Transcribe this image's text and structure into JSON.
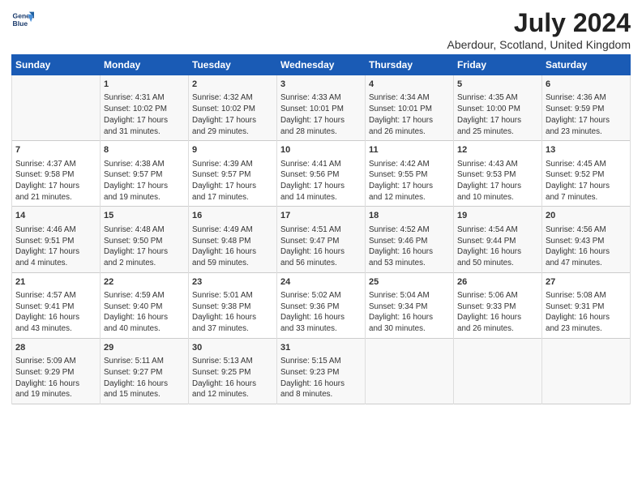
{
  "header": {
    "logo_line1": "General",
    "logo_line2": "Blue",
    "title": "July 2024",
    "subtitle": "Aberdour, Scotland, United Kingdom"
  },
  "days": [
    "Sunday",
    "Monday",
    "Tuesday",
    "Wednesday",
    "Thursday",
    "Friday",
    "Saturday"
  ],
  "weeks": [
    [
      {
        "date": "",
        "lines": []
      },
      {
        "date": "1",
        "lines": [
          "Sunrise: 4:31 AM",
          "Sunset: 10:02 PM",
          "Daylight: 17 hours",
          "and 31 minutes."
        ]
      },
      {
        "date": "2",
        "lines": [
          "Sunrise: 4:32 AM",
          "Sunset: 10:02 PM",
          "Daylight: 17 hours",
          "and 29 minutes."
        ]
      },
      {
        "date": "3",
        "lines": [
          "Sunrise: 4:33 AM",
          "Sunset: 10:01 PM",
          "Daylight: 17 hours",
          "and 28 minutes."
        ]
      },
      {
        "date": "4",
        "lines": [
          "Sunrise: 4:34 AM",
          "Sunset: 10:01 PM",
          "Daylight: 17 hours",
          "and 26 minutes."
        ]
      },
      {
        "date": "5",
        "lines": [
          "Sunrise: 4:35 AM",
          "Sunset: 10:00 PM",
          "Daylight: 17 hours",
          "and 25 minutes."
        ]
      },
      {
        "date": "6",
        "lines": [
          "Sunrise: 4:36 AM",
          "Sunset: 9:59 PM",
          "Daylight: 17 hours",
          "and 23 minutes."
        ]
      }
    ],
    [
      {
        "date": "7",
        "lines": [
          "Sunrise: 4:37 AM",
          "Sunset: 9:58 PM",
          "Daylight: 17 hours",
          "and 21 minutes."
        ]
      },
      {
        "date": "8",
        "lines": [
          "Sunrise: 4:38 AM",
          "Sunset: 9:57 PM",
          "Daylight: 17 hours",
          "and 19 minutes."
        ]
      },
      {
        "date": "9",
        "lines": [
          "Sunrise: 4:39 AM",
          "Sunset: 9:57 PM",
          "Daylight: 17 hours",
          "and 17 minutes."
        ]
      },
      {
        "date": "10",
        "lines": [
          "Sunrise: 4:41 AM",
          "Sunset: 9:56 PM",
          "Daylight: 17 hours",
          "and 14 minutes."
        ]
      },
      {
        "date": "11",
        "lines": [
          "Sunrise: 4:42 AM",
          "Sunset: 9:55 PM",
          "Daylight: 17 hours",
          "and 12 minutes."
        ]
      },
      {
        "date": "12",
        "lines": [
          "Sunrise: 4:43 AM",
          "Sunset: 9:53 PM",
          "Daylight: 17 hours",
          "and 10 minutes."
        ]
      },
      {
        "date": "13",
        "lines": [
          "Sunrise: 4:45 AM",
          "Sunset: 9:52 PM",
          "Daylight: 17 hours",
          "and 7 minutes."
        ]
      }
    ],
    [
      {
        "date": "14",
        "lines": [
          "Sunrise: 4:46 AM",
          "Sunset: 9:51 PM",
          "Daylight: 17 hours",
          "and 4 minutes."
        ]
      },
      {
        "date": "15",
        "lines": [
          "Sunrise: 4:48 AM",
          "Sunset: 9:50 PM",
          "Daylight: 17 hours",
          "and 2 minutes."
        ]
      },
      {
        "date": "16",
        "lines": [
          "Sunrise: 4:49 AM",
          "Sunset: 9:48 PM",
          "Daylight: 16 hours",
          "and 59 minutes."
        ]
      },
      {
        "date": "17",
        "lines": [
          "Sunrise: 4:51 AM",
          "Sunset: 9:47 PM",
          "Daylight: 16 hours",
          "and 56 minutes."
        ]
      },
      {
        "date": "18",
        "lines": [
          "Sunrise: 4:52 AM",
          "Sunset: 9:46 PM",
          "Daylight: 16 hours",
          "and 53 minutes."
        ]
      },
      {
        "date": "19",
        "lines": [
          "Sunrise: 4:54 AM",
          "Sunset: 9:44 PM",
          "Daylight: 16 hours",
          "and 50 minutes."
        ]
      },
      {
        "date": "20",
        "lines": [
          "Sunrise: 4:56 AM",
          "Sunset: 9:43 PM",
          "Daylight: 16 hours",
          "and 47 minutes."
        ]
      }
    ],
    [
      {
        "date": "21",
        "lines": [
          "Sunrise: 4:57 AM",
          "Sunset: 9:41 PM",
          "Daylight: 16 hours",
          "and 43 minutes."
        ]
      },
      {
        "date": "22",
        "lines": [
          "Sunrise: 4:59 AM",
          "Sunset: 9:40 PM",
          "Daylight: 16 hours",
          "and 40 minutes."
        ]
      },
      {
        "date": "23",
        "lines": [
          "Sunrise: 5:01 AM",
          "Sunset: 9:38 PM",
          "Daylight: 16 hours",
          "and 37 minutes."
        ]
      },
      {
        "date": "24",
        "lines": [
          "Sunrise: 5:02 AM",
          "Sunset: 9:36 PM",
          "Daylight: 16 hours",
          "and 33 minutes."
        ]
      },
      {
        "date": "25",
        "lines": [
          "Sunrise: 5:04 AM",
          "Sunset: 9:34 PM",
          "Daylight: 16 hours",
          "and 30 minutes."
        ]
      },
      {
        "date": "26",
        "lines": [
          "Sunrise: 5:06 AM",
          "Sunset: 9:33 PM",
          "Daylight: 16 hours",
          "and 26 minutes."
        ]
      },
      {
        "date": "27",
        "lines": [
          "Sunrise: 5:08 AM",
          "Sunset: 9:31 PM",
          "Daylight: 16 hours",
          "and 23 minutes."
        ]
      }
    ],
    [
      {
        "date": "28",
        "lines": [
          "Sunrise: 5:09 AM",
          "Sunset: 9:29 PM",
          "Daylight: 16 hours",
          "and 19 minutes."
        ]
      },
      {
        "date": "29",
        "lines": [
          "Sunrise: 5:11 AM",
          "Sunset: 9:27 PM",
          "Daylight: 16 hours",
          "and 15 minutes."
        ]
      },
      {
        "date": "30",
        "lines": [
          "Sunrise: 5:13 AM",
          "Sunset: 9:25 PM",
          "Daylight: 16 hours",
          "and 12 minutes."
        ]
      },
      {
        "date": "31",
        "lines": [
          "Sunrise: 5:15 AM",
          "Sunset: 9:23 PM",
          "Daylight: 16 hours",
          "and 8 minutes."
        ]
      },
      {
        "date": "",
        "lines": []
      },
      {
        "date": "",
        "lines": []
      },
      {
        "date": "",
        "lines": []
      }
    ]
  ]
}
